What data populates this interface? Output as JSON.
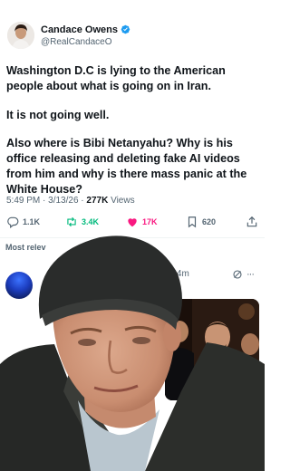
{
  "tweet": {
    "author": {
      "name": "Candace Owens",
      "handle": "@RealCandaceO",
      "verified_color": "#1d9bf0"
    },
    "paragraphs": [
      "Washington D.C is lying to the American people about what is going on in Iran.",
      "It is not going well.",
      "Also where is Bibi Netanyahu? Why is his office releasing and deleting fake AI videos from him and why is there mass panic at the White House?"
    ],
    "meta": {
      "time": "5:49 PM",
      "separator": " · ",
      "date": "3/13/26",
      "views_count": "277K",
      "views_label": " Views"
    },
    "actions": {
      "replies": "1.1K",
      "reposts": "3.4K",
      "likes": "17K",
      "bookmarks": "620"
    },
    "colors": {
      "repost": "#00ba7c",
      "like": "#f91880",
      "muted": "#536471"
    }
  },
  "replies_section": {
    "sort_label": "Most relev",
    "reply": {
      "time": "·44m",
      "icons": [
        "grok-icon",
        "more-icon"
      ]
    }
  }
}
